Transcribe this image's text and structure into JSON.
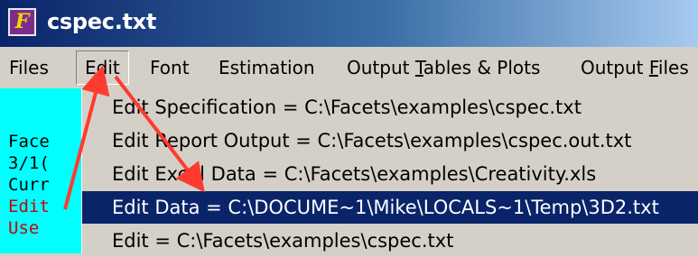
{
  "window": {
    "title": "cspec.txt",
    "app_icon_letter": "F"
  },
  "menubar": {
    "items": [
      {
        "label": "Files"
      },
      {
        "label": "Edit"
      },
      {
        "label": "Font"
      },
      {
        "label": "Estimation"
      },
      {
        "label_pre": "Output ",
        "label_u": "T",
        "label_post": "ables & Plots"
      },
      {
        "label_pre": "Output ",
        "label_u": "F",
        "label_post": "iles"
      }
    ]
  },
  "left_panel": {
    "lines": [
      "Face",
      "3/1(",
      "Curr",
      "Edit",
      "Use"
    ]
  },
  "edit_menu": {
    "items": [
      "Edit Specification = C:\\Facets\\examples\\cspec.txt",
      "Edit Report Output = C:\\Facets\\examples\\cspec.out.txt",
      "Edit Excel Data = C:\\Facets\\examples\\Creativity.xls",
      "Edit Data = C:\\DOCUME~1\\Mike\\LOCALS~1\\Temp\\3D2.txt",
      "Edit = C:\\Facets\\examples\\cspec.txt"
    ],
    "selected_index": 3
  },
  "colors": {
    "selection": "#0a246a",
    "annotation_arrow": "#ff3b30",
    "panel_bg": "#00ffff"
  }
}
